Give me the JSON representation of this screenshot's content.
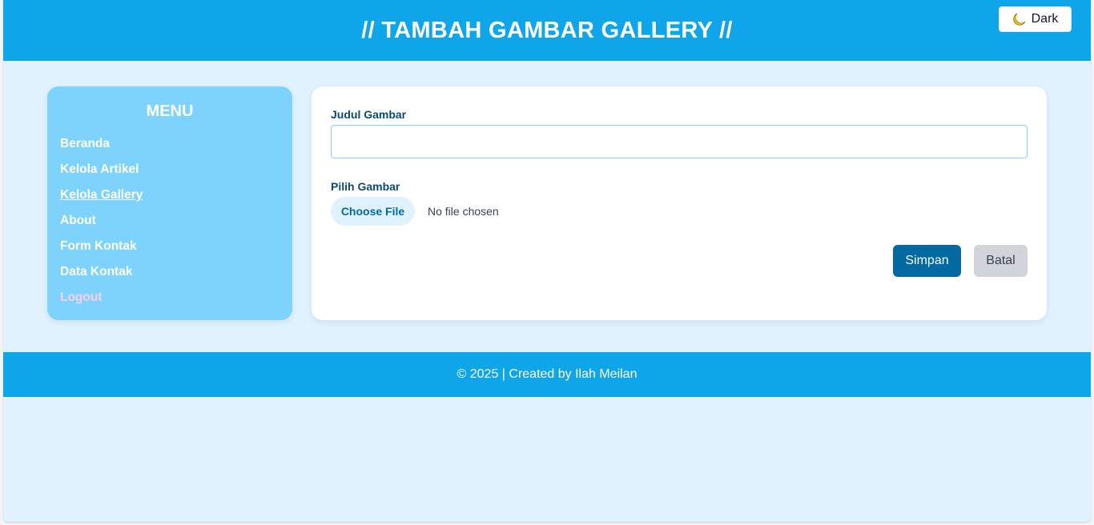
{
  "header": {
    "title": "// TAMBAH GAMBAR GALLERY //",
    "dark_toggle_label": "Dark",
    "dark_toggle_icon": "moon-icon"
  },
  "sidebar": {
    "title": "MENU",
    "items": [
      {
        "label": "Beranda"
      },
      {
        "label": "Kelola Artikel"
      },
      {
        "label": "Kelola Gallery",
        "active": true
      },
      {
        "label": "About"
      },
      {
        "label": "Form Kontak"
      },
      {
        "label": "Data Kontak"
      },
      {
        "label": "Logout"
      }
    ]
  },
  "form": {
    "title_label": "Judul Gambar",
    "title_value": "",
    "image_label": "Pilih Gambar",
    "file_button_label": "Choose File",
    "file_status": "No file chosen",
    "save_label": "Simpan",
    "cancel_label": "Batal"
  },
  "footer": {
    "text": "© 2025 | Created by Ilah Meilan"
  },
  "colors": {
    "header_bg": "#0ea5e9",
    "page_bg": "#e0f2fe",
    "sidebar_bg": "#7dd3fc",
    "save_button": "#0369a1",
    "cancel_button": "#d1d5db",
    "logout_text": "#fbcfe8"
  }
}
